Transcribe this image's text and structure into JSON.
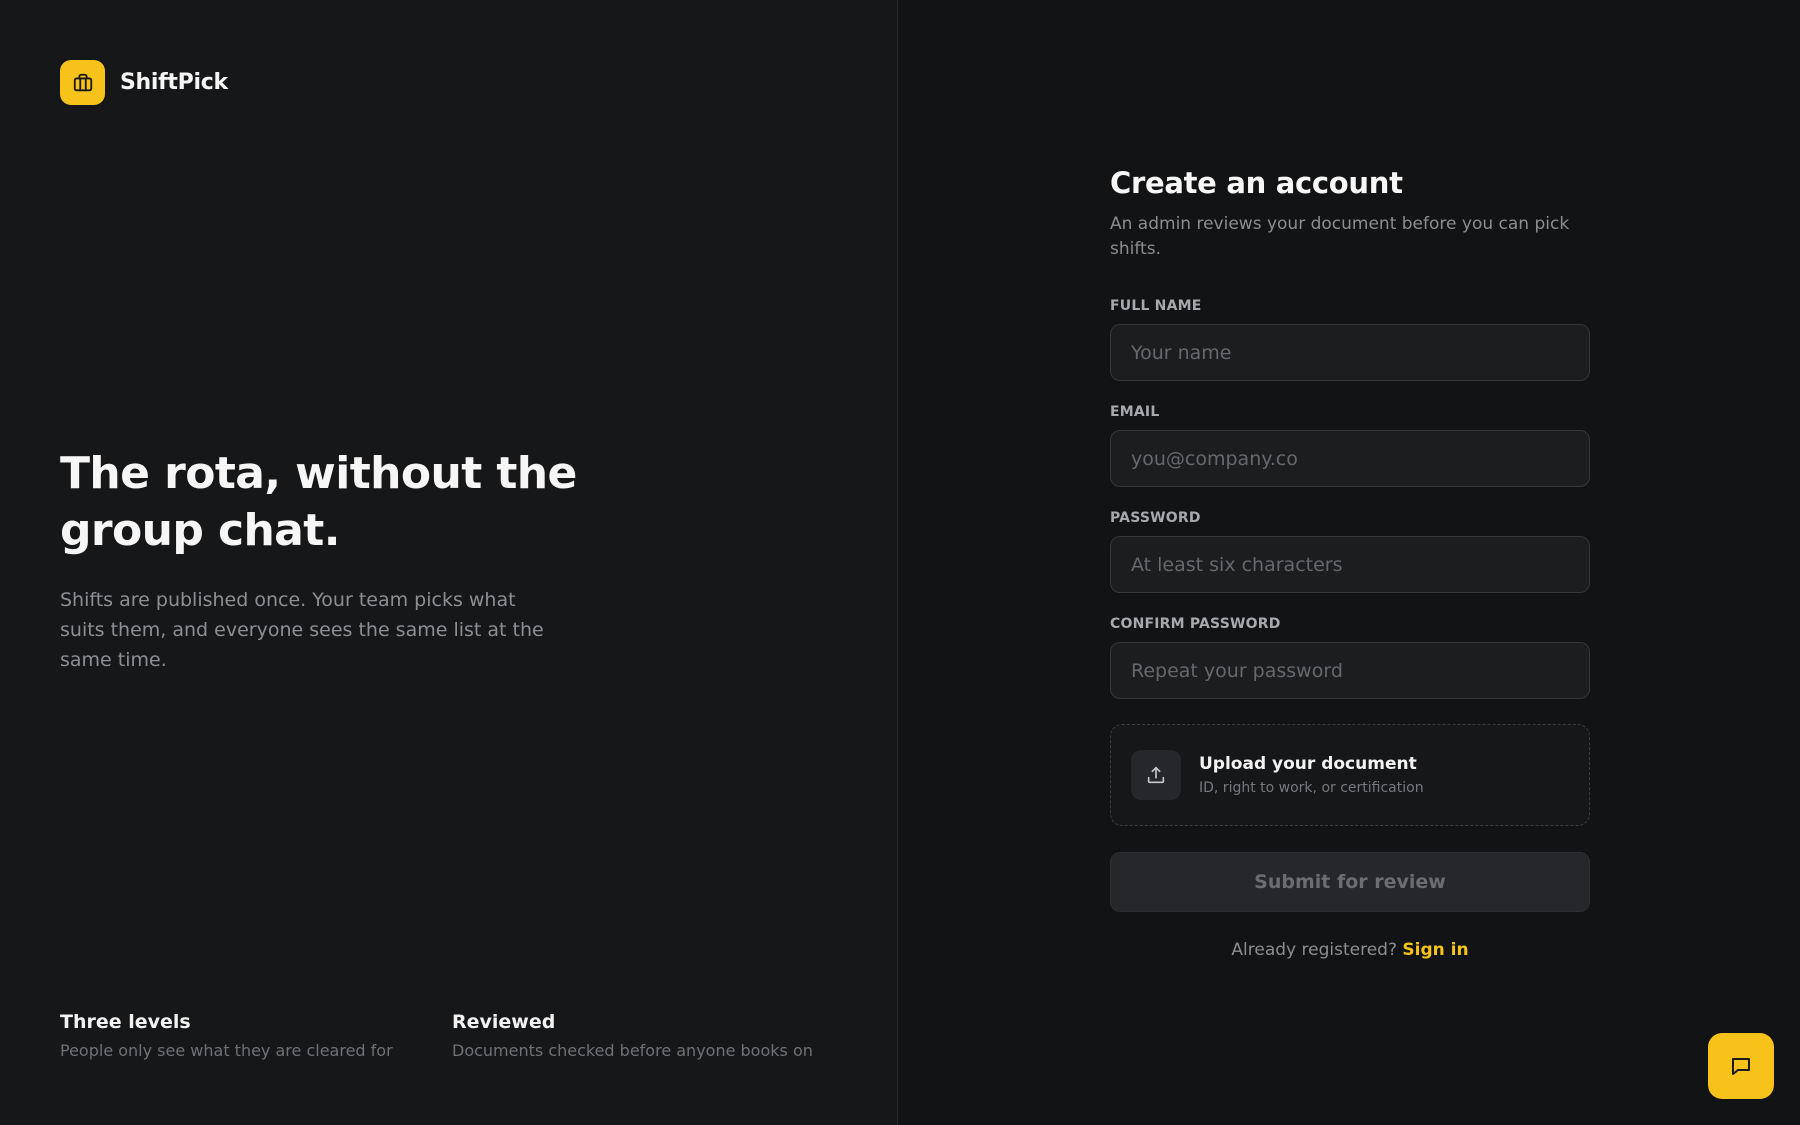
{
  "brand": {
    "name": "ShiftPick",
    "icon": "briefcase-icon",
    "accent_color": "#f7c21a"
  },
  "hero": {
    "title": "The rota, without the group chat.",
    "description": "Shifts are published once. Your team picks what suits them, and everyone sees the same list at the same time."
  },
  "features": [
    {
      "title": "Three levels",
      "description": "People only see what they are cleared for"
    },
    {
      "title": "Reviewed",
      "description": "Documents checked before anyone books on"
    }
  ],
  "form": {
    "title": "Create an account",
    "subtitle": "An admin reviews your document before you can pick shifts.",
    "fields": {
      "full_name": {
        "label": "FULL NAME",
        "placeholder": "Your name",
        "value": ""
      },
      "email": {
        "label": "EMAIL",
        "placeholder": "you@company.co",
        "value": ""
      },
      "password": {
        "label": "PASSWORD",
        "placeholder": "At least six characters",
        "value": ""
      },
      "confirm_password": {
        "label": "CONFIRM PASSWORD",
        "placeholder": "Repeat your password",
        "value": ""
      }
    },
    "upload": {
      "title": "Upload your document",
      "hint": "ID, right to work, or certification",
      "icon": "upload-icon"
    },
    "submit_label": "Submit for review",
    "signin_prompt": "Already registered?",
    "signin_link": "Sign in"
  },
  "chat": {
    "icon": "chat-bubble-icon"
  }
}
